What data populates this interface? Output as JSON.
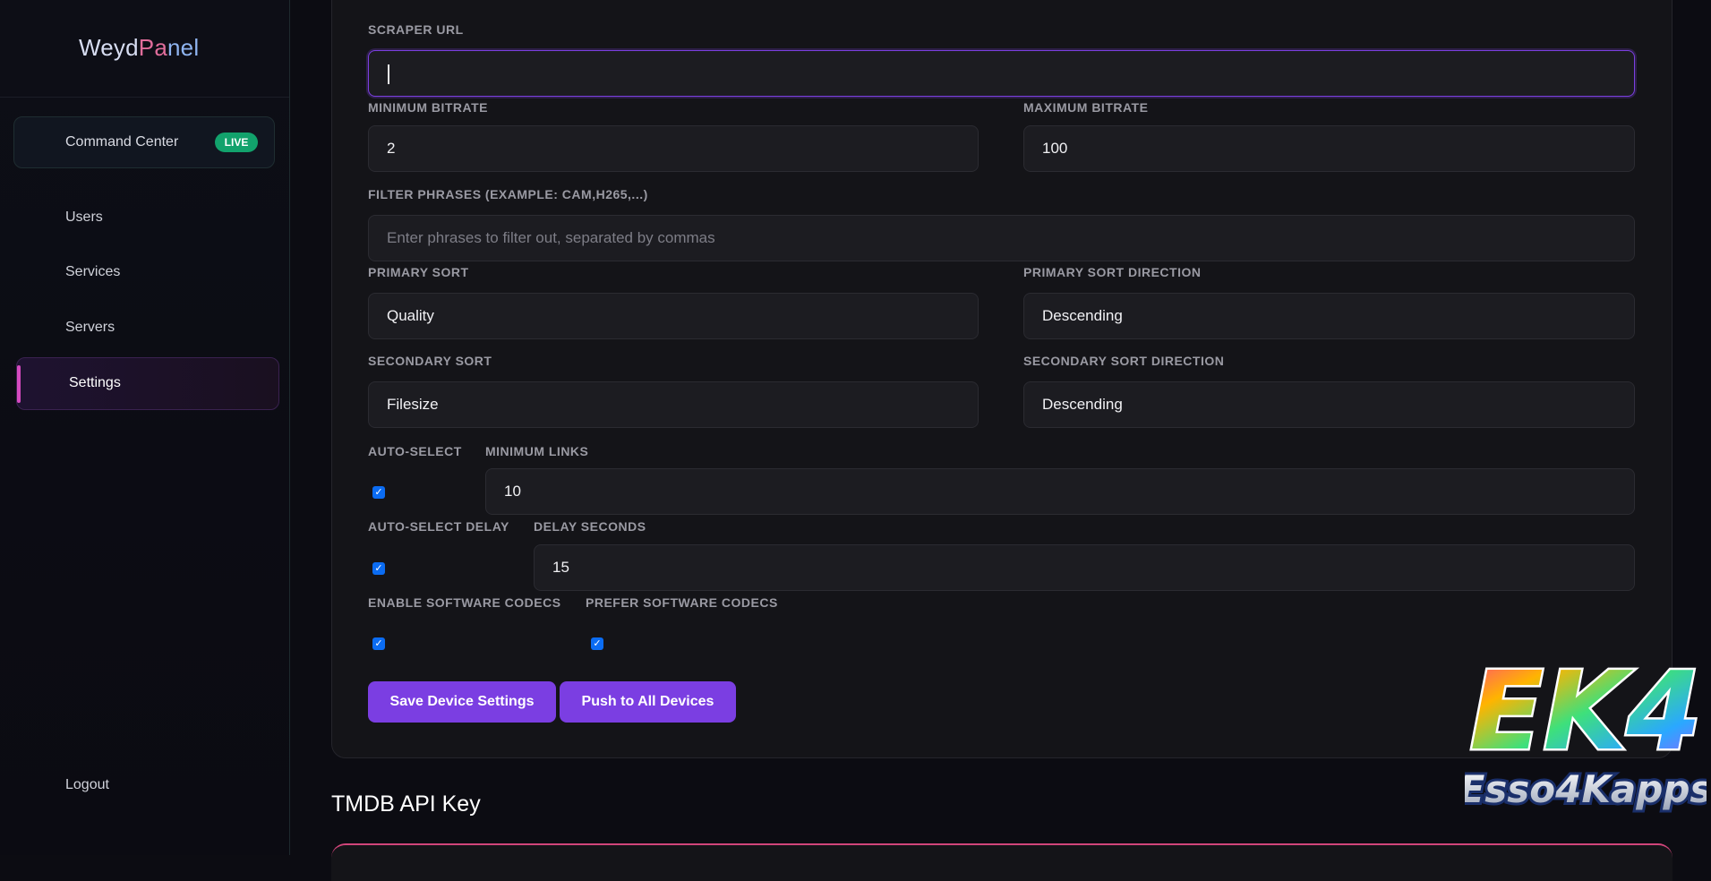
{
  "sidebar": {
    "logo": {
      "part1": "Weyd",
      "part2": "Pa",
      "part3": "nel"
    },
    "command_center": {
      "label": "Command Center",
      "badge": "LIVE"
    },
    "items": [
      {
        "label": "Users"
      },
      {
        "label": "Services"
      },
      {
        "label": "Servers"
      },
      {
        "label": "Settings",
        "active": true
      }
    ],
    "logout": "Logout"
  },
  "form": {
    "scraper_url": {
      "label": "SCRAPER URL",
      "value": ""
    },
    "min_bitrate": {
      "label": "MINIMUM BITRATE",
      "value": "2"
    },
    "max_bitrate": {
      "label": "MAXIMUM BITRATE",
      "value": "100"
    },
    "filter_phrases": {
      "label": "FILTER PHRASES (EXAMPLE: CAM,H265,...)",
      "placeholder": "Enter phrases to filter out, separated by commas"
    },
    "primary_sort": {
      "label": "PRIMARY SORT",
      "value": "Quality"
    },
    "primary_sort_direction": {
      "label": "PRIMARY SORT DIRECTION",
      "value": "Descending"
    },
    "secondary_sort": {
      "label": "SECONDARY SORT",
      "value": "Filesize"
    },
    "secondary_sort_direction": {
      "label": "SECONDARY SORT DIRECTION",
      "value": "Descending"
    },
    "auto_select": {
      "label": "AUTO-SELECT",
      "checked": true
    },
    "minimum_links": {
      "label": "MINIMUM LINKS",
      "value": "10"
    },
    "auto_select_delay": {
      "label": "AUTO-SELECT DELAY",
      "checked": true
    },
    "delay_seconds": {
      "label": "DELAY SECONDS",
      "value": "15"
    },
    "enable_software_codecs": {
      "label": "ENABLE SOFTWARE CODECS",
      "checked": true
    },
    "prefer_software_codecs": {
      "label": "PREFER SOFTWARE CODECS",
      "checked": true
    },
    "save_button": "Save Device Settings",
    "push_button": "Push to All Devices"
  },
  "tmdb_section": {
    "title": "TMDB API Key"
  },
  "watermark": {
    "line1": "EK4",
    "line2": "Esso4Kapps"
  },
  "colors": {
    "accent": "#7b3ee2",
    "live_badge": "#12a26c",
    "checkbox": "#0b6cf2",
    "active_bar": "#d54abf"
  }
}
